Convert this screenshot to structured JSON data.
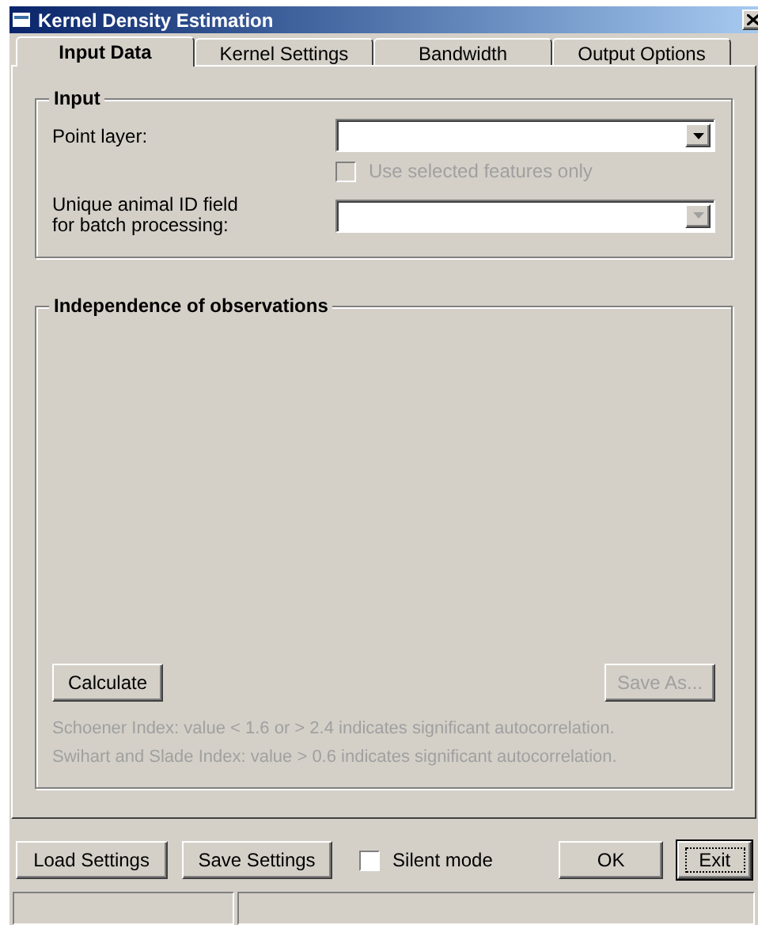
{
  "window": {
    "title": "Kernel Density Estimation"
  },
  "tabs": [
    {
      "label": "Input Data",
      "selected": true
    },
    {
      "label": "Kernel Settings",
      "selected": false
    },
    {
      "label": "Bandwidth",
      "selected": false
    },
    {
      "label": "Output Options",
      "selected": false
    }
  ],
  "input_group": {
    "title": "Input",
    "point_layer": {
      "label": "Point layer:",
      "disabled": false
    },
    "selected_only": {
      "label": "Use selected features only",
      "checked": false,
      "disabled": true
    },
    "animal_id": {
      "label": "Unique animal ID field for batch processing:",
      "disabled": true
    }
  },
  "independence_group": {
    "title": "Independence of observations",
    "calculate": {
      "label": "Calculate",
      "disabled": false
    },
    "save_as": {
      "label": "Save As...",
      "disabled": true
    },
    "notes": [
      "Schoener Index: value < 1.6 or > 2.4 indicates significant autocorrelation.",
      "Swihart and Slade Index: value > 0.6 indicates significant autocorrelation."
    ]
  },
  "footer": {
    "load": {
      "label": "Load Settings",
      "focused": false
    },
    "save": {
      "label": "Save Settings",
      "focused": false
    },
    "silent_mode": {
      "label": "Silent mode",
      "checked": false
    },
    "ok": {
      "label": "OK",
      "focused": false
    },
    "exit": {
      "label": "Exit",
      "focused": true
    }
  }
}
